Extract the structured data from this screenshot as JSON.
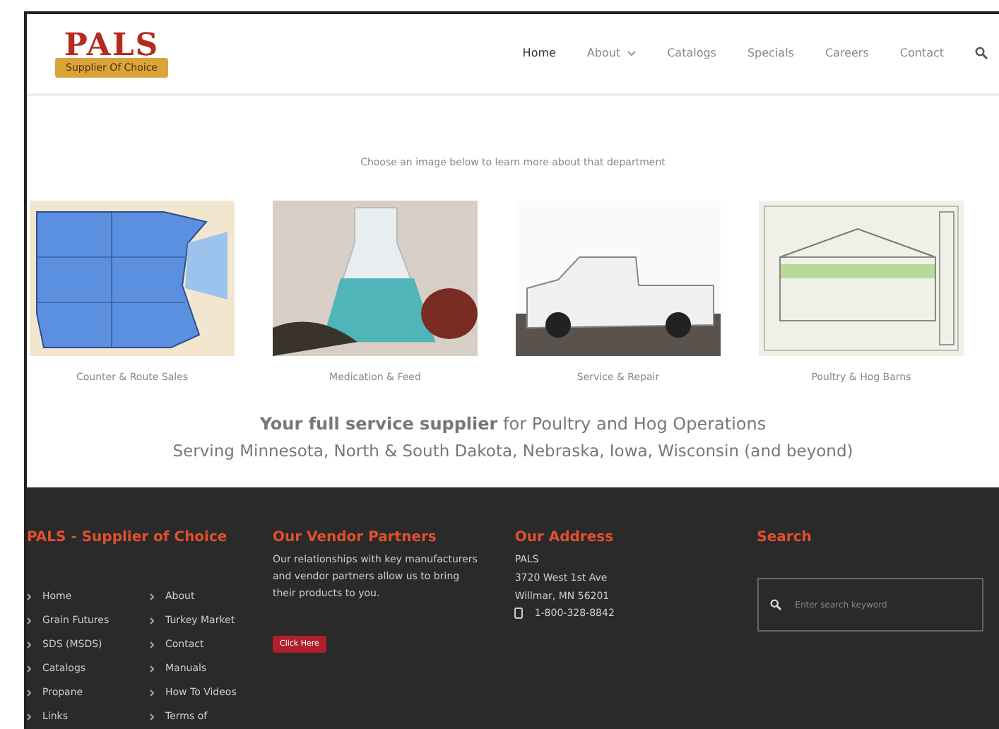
{
  "header": {
    "logo": {
      "name": "PALS",
      "tagline": "Supplier Of Choice"
    },
    "nav": [
      {
        "label": "Home",
        "selected": true,
        "dropdown": false
      },
      {
        "label": "About",
        "selected": false,
        "dropdown": true
      },
      {
        "label": "Catalogs",
        "selected": false,
        "dropdown": false
      },
      {
        "label": "Specials",
        "selected": false,
        "dropdown": false
      },
      {
        "label": "Careers",
        "selected": false,
        "dropdown": false
      },
      {
        "label": "Contact",
        "selected": false,
        "dropdown": false
      }
    ]
  },
  "intro": "Choose an image below to learn more about that department",
  "departments": [
    {
      "caption": "Counter & Route Sales",
      "kind": "map"
    },
    {
      "caption": "Medication & Feed",
      "kind": "flask"
    },
    {
      "caption": "Service & Repair",
      "kind": "truck"
    },
    {
      "caption": "Poultry & Hog Barns",
      "kind": "blueprint"
    }
  ],
  "headline": "**Your full service supplier** for Poultry and Hog Operations",
  "subline": "Serving Minnesota, North & South Dakota, Nebraska, Iowa, Wisconsin (and beyond)",
  "footer": {
    "links": {
      "title": "PALS - Supplier of Choice",
      "column_1": [
        "Home",
        "Grain Futures",
        "SDS (MSDS)",
        "Catalogs",
        "Propane",
        "Links"
      ],
      "column_2": [
        "About",
        "Turkey Market",
        "Contact",
        "Manuals",
        "How To Videos",
        "Terms of"
      ]
    },
    "partners": {
      "title": "Our Vendor Partners",
      "text": "Our relationships with key manufacturers and vendor partners allow us to bring their products to you.",
      "button": "Click Here"
    },
    "address": {
      "title": "Our Address",
      "lines": [
        "PALS",
        "3720 West 1st Ave",
        "Willmar, MN 56201"
      ],
      "phone": "1-800-328-8842"
    },
    "search": {
      "title": "Search",
      "placeholder": "Enter search keyword"
    }
  }
}
